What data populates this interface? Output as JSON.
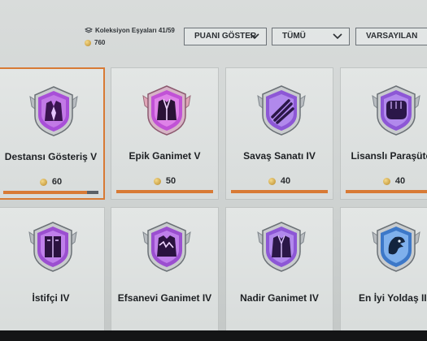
{
  "header": {
    "collection_label": "Koleksiyon Eşyaları",
    "collection_count": "41/59",
    "coins": "760",
    "dropdowns": [
      {
        "label": "PUANI GÖSTER"
      },
      {
        "label": "TÜMÜ"
      },
      {
        "label": "VARSAYILAN"
      }
    ]
  },
  "colors": {
    "accent": "#d87a35",
    "badge_purple": "#9b4fd0",
    "badge_blue": "#4b8fd8"
  },
  "cards": [
    {
      "name": "Destansı Gösteriş V",
      "price": "60",
      "icon": "suit-icon",
      "progress": 0.88
    },
    {
      "name": "Epik Ganimet V",
      "price": "50",
      "icon": "jacket-icon",
      "progress": 1.0
    },
    {
      "name": "Savaş Sanatı IV",
      "price": "40",
      "icon": "claw-icon",
      "progress": 1.0
    },
    {
      "name": "Lisanslı Paraşütçü",
      "price": "40",
      "icon": "fist-icon",
      "progress": 1.0
    },
    {
      "name": "İstifçi IV",
      "icon": "locker-icon"
    },
    {
      "name": "Efsanevi Ganimet IV",
      "icon": "zigzag-jacket-icon"
    },
    {
      "name": "Nadir Ganimet IV",
      "icon": "coat-icon"
    },
    {
      "name": "En İyi Yoldaş III",
      "icon": "eagle-icon"
    }
  ]
}
